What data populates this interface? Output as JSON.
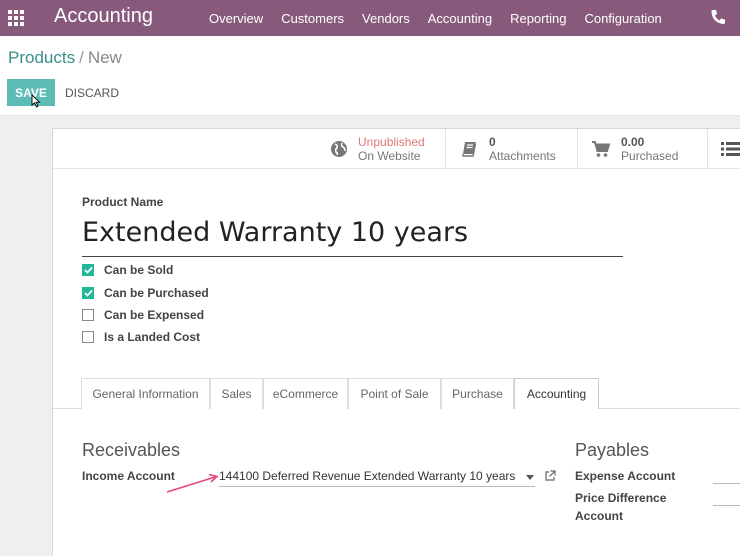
{
  "navbar": {
    "app_title": "Accounting",
    "menu": [
      "Overview",
      "Customers",
      "Vendors",
      "Accounting",
      "Reporting",
      "Configuration"
    ]
  },
  "breadcrumb": {
    "parent": "Products",
    "separator": "/",
    "current": "New"
  },
  "actions": {
    "save": "SAVE",
    "discard": "DISCARD"
  },
  "stat_buttons": {
    "website": {
      "value": "Unpublished",
      "label": "On Website"
    },
    "attachments": {
      "value": "0",
      "label": "Attachments"
    },
    "purchased": {
      "value": "0.00",
      "label": "Purchased"
    }
  },
  "form": {
    "product_name_label": "Product Name",
    "product_name": "Extended Warranty 10 years",
    "checkboxes": [
      {
        "label": "Can be Sold",
        "checked": true
      },
      {
        "label": "Can be Purchased",
        "checked": true
      },
      {
        "label": "Can be Expensed",
        "checked": false
      },
      {
        "label": "Is a Landed Cost",
        "checked": false
      }
    ]
  },
  "tabs": [
    {
      "label": "General Information",
      "active": false
    },
    {
      "label": "Sales",
      "active": false
    },
    {
      "label": "eCommerce",
      "active": false
    },
    {
      "label": "Point of Sale",
      "active": false
    },
    {
      "label": "Purchase",
      "active": false
    },
    {
      "label": "Accounting",
      "active": true
    }
  ],
  "accounting": {
    "receivables_title": "Receivables",
    "income_account_label": "Income Account",
    "income_account_value": "144100 Deferred Revenue Extended Warranty 10 years",
    "payables_title": "Payables",
    "expense_account_label": "Expense Account",
    "price_difference_label_1": "Price Difference",
    "price_difference_label_2": "Account"
  },
  "colors": {
    "navbar": "#875a7b",
    "primary_button": "#5cbbb5",
    "link": "#3a8d86",
    "checkbox_checked": "#21b799",
    "unpublished": "#e17777",
    "annotation_arrow": "#e8447f"
  },
  "icons": [
    "apps-grid-icon",
    "phone-icon",
    "globe-icon",
    "book-icon",
    "cart-icon",
    "list-icon",
    "chevron-down-icon",
    "external-link-icon",
    "mouse-cursor-icon"
  ]
}
